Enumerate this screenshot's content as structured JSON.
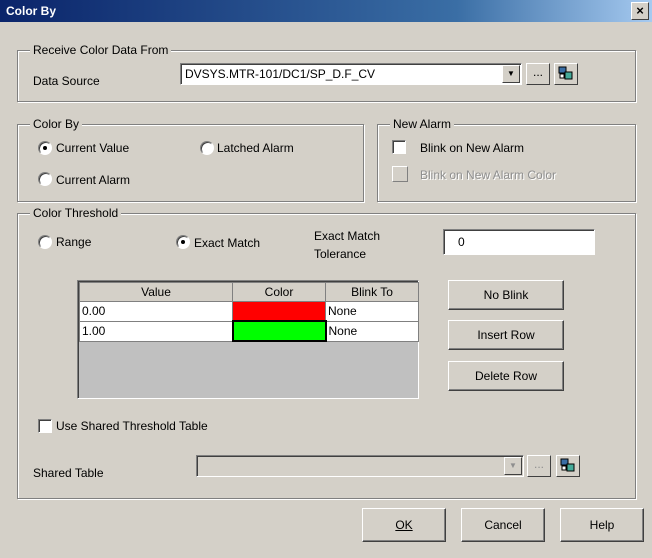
{
  "window": {
    "title": "Color By",
    "close_glyph": "×"
  },
  "receive": {
    "legend": "Receive Color Data From",
    "data_source_label": "Data Source",
    "data_source_value": "DVSYS.MTR-101/DC1/SP_D.F_CV",
    "browse_label": "..."
  },
  "color_by": {
    "legend": "Color By",
    "current_value": "Current Value",
    "latched_alarm": "Latched Alarm",
    "current_alarm": "Current Alarm",
    "selected": "current_value"
  },
  "new_alarm": {
    "legend": "New Alarm",
    "blink": "Blink on New Alarm",
    "blink_color": "Blink on New Alarm Color"
  },
  "threshold": {
    "legend": "Color Threshold",
    "range": "Range",
    "exact_match": "Exact Match",
    "tolerance_label_1": "Exact Match",
    "tolerance_label_2": "Tolerance",
    "tolerance_value": "0",
    "columns": [
      "Value",
      "Color",
      "Blink To"
    ],
    "rows": [
      {
        "value": "0.00",
        "color": "#ff0000",
        "blink": "None"
      },
      {
        "value": "1.00",
        "color": "#00ff00",
        "blink": "None"
      }
    ],
    "no_blink": "No Blink",
    "insert_row": "Insert Row",
    "delete_row": "Delete Row",
    "use_shared": "Use Shared Threshold Table",
    "shared_table_label": "Shared Table",
    "shared_browse": "..."
  },
  "footer": {
    "ok": "OK",
    "cancel": "Cancel",
    "help": "Help"
  }
}
